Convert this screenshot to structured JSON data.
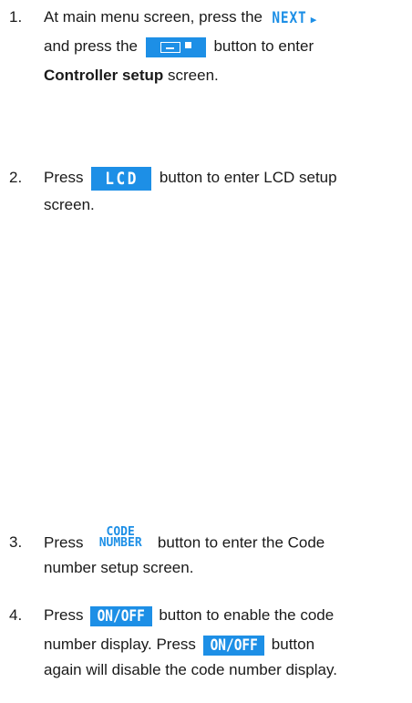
{
  "steps": [
    {
      "number": "1.",
      "line1_pre": "At main menu screen, press the ",
      "next_button": "NEXT",
      "line2_pre": "and press the ",
      "line2_post": " button to enter",
      "bold_term": "Controller setup",
      "line3_post": " screen."
    },
    {
      "number": "2.",
      "pre": "Press ",
      "lcd_button": "LCD",
      "post": " button to enter LCD setup",
      "line2": "screen."
    },
    {
      "number": "3.",
      "pre": "Press ",
      "code_button_top": "CODE",
      "code_button_bottom": "NUMBER",
      "post": " button to enter the Code",
      "line2": "number setup screen."
    },
    {
      "number": "4.",
      "pre": "Press ",
      "onoff_button": "ON/OFF",
      "post": " button to enable the code",
      "line2_pre": "number display. Press ",
      "line2_post": " button",
      "line3": "again will disable the code number display."
    }
  ],
  "icons": {
    "next_arrow": "right-triangle-icon",
    "controller_button": "controller-panel-icon"
  },
  "colors": {
    "button_blue": "#1d8fe6"
  }
}
